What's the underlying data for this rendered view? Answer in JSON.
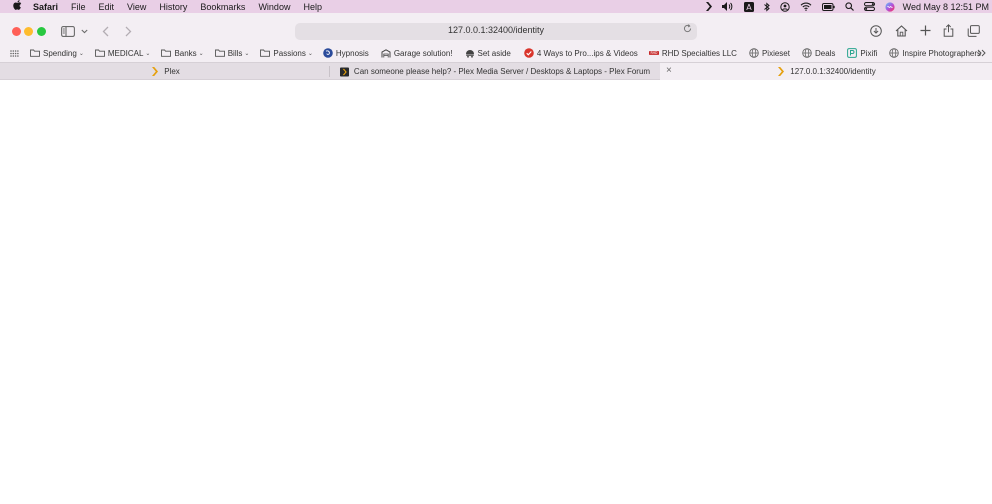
{
  "menubar": {
    "app_name": "Safari",
    "items": [
      "File",
      "Edit",
      "View",
      "History",
      "Bookmarks",
      "Window",
      "Help"
    ],
    "clock": "Wed May 8  12:51 PM"
  },
  "toolbar": {
    "url": "127.0.0.1:32400/identity"
  },
  "bookmarks": [
    {
      "label": "Spending",
      "icon": "folder-icon",
      "menu": true
    },
    {
      "label": "MEDICAL",
      "icon": "folder-icon",
      "menu": true
    },
    {
      "label": "Banks",
      "icon": "folder-icon",
      "menu": true
    },
    {
      "label": "Bills",
      "icon": "folder-icon",
      "menu": true
    },
    {
      "label": "Passions",
      "icon": "folder-icon",
      "menu": true
    },
    {
      "label": "Hypnosis",
      "icon": "site-icon",
      "menu": false
    },
    {
      "label": "Garage solution!",
      "icon": "site-icon",
      "menu": false
    },
    {
      "label": "Set aside",
      "icon": "site-icon",
      "menu": false
    },
    {
      "label": "4 Ways to Pro...ips & Videos",
      "icon": "site-icon",
      "menu": false
    },
    {
      "label": "RHD Specialties LLC",
      "icon": "site-icon",
      "menu": false
    },
    {
      "label": "Pixieset",
      "icon": "globe-icon",
      "menu": false
    },
    {
      "label": "Deals",
      "icon": "globe-icon",
      "menu": false
    },
    {
      "label": "Pixifi",
      "icon": "site-icon",
      "menu": false
    },
    {
      "label": "Inspire Photographers",
      "icon": "globe-icon",
      "menu": false
    }
  ],
  "tabs": [
    {
      "title": "Plex"
    },
    {
      "title": "Can someone please help? - Plex Media Server / Desktops & Laptops - Plex Forum"
    },
    {
      "title": "127.0.0.1:32400/identity"
    }
  ],
  "colors": {
    "menubar": "#e9cfe6",
    "toolbar": "#f3eef3",
    "close": "#ff5f57",
    "minimize": "#febc2e",
    "zoom": "#28c840",
    "plex_orange": "#e5a00d"
  }
}
